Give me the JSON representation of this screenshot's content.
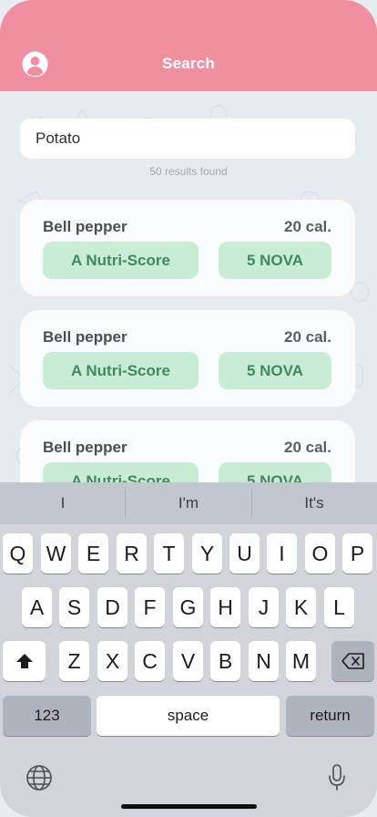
{
  "header": {
    "title": "Search",
    "profile_icon": "user-circle-icon"
  },
  "search": {
    "value": "Potato",
    "results_text": "50 results found"
  },
  "results": [
    {
      "name": "Bell pepper",
      "calories": "20 cal.",
      "nutri_score": "A Nutri-Score",
      "nova": "5 NOVA"
    },
    {
      "name": "Bell pepper",
      "calories": "20 cal.",
      "nutri_score": "A Nutri-Score",
      "nova": "5 NOVA"
    },
    {
      "name": "Bell pepper",
      "calories": "20 cal.",
      "nutri_score": "A Nutri-Score",
      "nova": "5 NOVA"
    }
  ],
  "colors": {
    "header": "#ef8fa0",
    "chip_bg": "#c9ecd5",
    "chip_text": "#3f8a5c"
  },
  "keyboard": {
    "suggestions": [
      "I",
      "I'm",
      "It's"
    ],
    "row1": [
      "Q",
      "W",
      "E",
      "R",
      "T",
      "Y",
      "U",
      "I",
      "O",
      "P"
    ],
    "row2": [
      "A",
      "S",
      "D",
      "F",
      "G",
      "H",
      "J",
      "K",
      "L"
    ],
    "row3": [
      "Z",
      "X",
      "C",
      "V",
      "B",
      "N",
      "M"
    ],
    "numbers_label": "123",
    "space_label": "space",
    "return_label": "return",
    "shift_icon": "shift-icon",
    "delete_icon": "backspace-icon",
    "globe_icon": "globe-icon",
    "mic_icon": "microphone-icon"
  }
}
